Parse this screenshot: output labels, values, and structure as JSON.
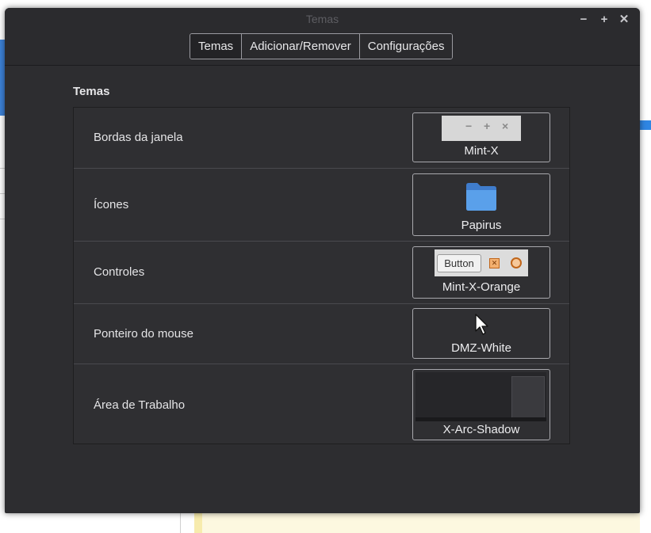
{
  "window": {
    "title": "Temas",
    "controls": {
      "minimize": "−",
      "maximize": "+",
      "close": "✕"
    }
  },
  "tabs": [
    {
      "label": "Temas",
      "active": true
    },
    {
      "label": "Adicionar/Remover",
      "active": false
    },
    {
      "label": "Configurações",
      "active": false
    }
  ],
  "section_title": "Temas",
  "rows": [
    {
      "label": "Bordas da janela",
      "theme": "Mint-X",
      "preview": "window-controls-icon"
    },
    {
      "label": "Ícones",
      "theme": "Papirus",
      "preview": "folder-icon"
    },
    {
      "label": "Controles",
      "theme": "Mint-X-Orange",
      "preview": "controls-preview"
    },
    {
      "label": "Ponteiro do mouse",
      "theme": "DMZ-White",
      "preview": "cursor-icon"
    },
    {
      "label": "Área de Trabalho",
      "theme": "X-Arc-Shadow",
      "preview": "desktop-preview"
    }
  ],
  "previews": {
    "wm_min": "−",
    "wm_max": "+",
    "wm_close": "×",
    "control_button": "Button",
    "control_check": "✕"
  },
  "colors": {
    "window_bg": "#2d2d30",
    "folder_blue": "#4a90d9",
    "accent_orange": "#c0651a"
  }
}
